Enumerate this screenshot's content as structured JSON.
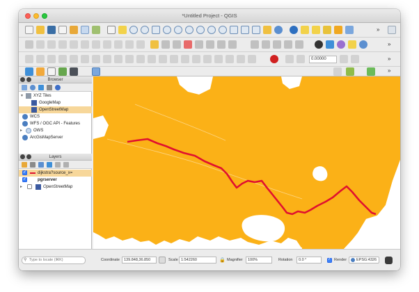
{
  "window": {
    "title": "*Untitled Project - QGIS"
  },
  "toolbar": {
    "scale_value": "0.00000"
  },
  "browser": {
    "title": "Browser",
    "items": [
      {
        "label": "XYZ Tiles",
        "icon": "xyz-tiles-icon"
      },
      {
        "label": "GoogleMap",
        "icon": "tile-layer-icon"
      },
      {
        "label": "OpenStreetMap",
        "icon": "tile-layer-icon",
        "selected": true
      },
      {
        "label": "WCS",
        "icon": "globe-icon"
      },
      {
        "label": "WFS / OGC API - Features",
        "icon": "globe-icon"
      },
      {
        "label": "OWS",
        "icon": "globe-icon"
      },
      {
        "label": "ArcGisMapServer",
        "icon": "globe-icon"
      }
    ]
  },
  "layers": {
    "title": "Layers",
    "items": [
      {
        "label": "dijkstra?source_x=",
        "checked": true,
        "icon": "line-layer-icon",
        "selected": true
      },
      {
        "label": "pgrserver",
        "checked": true,
        "icon": "",
        "bold": true
      },
      {
        "label": "OpenStreetMap",
        "checked": false,
        "icon": "tile-layer-icon",
        "italic": true
      }
    ]
  },
  "statusbar": {
    "locate_placeholder": "Type to locate (⌘K)",
    "coordinate_label": "Coordinate",
    "coordinate_value": "139.848,36.850",
    "scale_label": "Scale",
    "scale_value": "1:542260",
    "magnifier_label": "Magnifier",
    "magnifier_value": "100%",
    "rotation_label": "Rotation",
    "rotation_value": "0.0 °",
    "render_label": "Render",
    "crs_label": "EPSG:4326"
  },
  "colors": {
    "land": "#fbb117",
    "route": "#e0102f",
    "accent": "#3b82f6"
  }
}
